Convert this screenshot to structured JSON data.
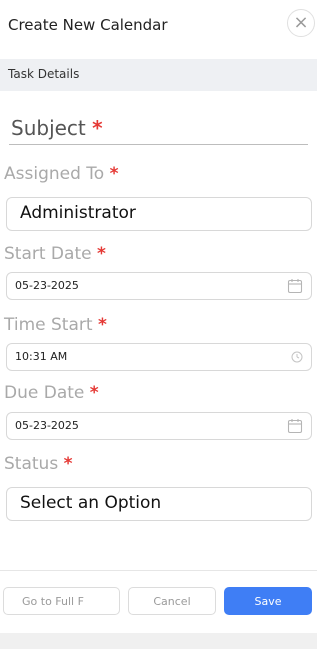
{
  "header": {
    "title": "Create New Calendar",
    "close_glyph": "×"
  },
  "section": {
    "title": "Task Details"
  },
  "form": {
    "required_mark": "*",
    "subject": {
      "label": "Subject"
    },
    "assigned_to": {
      "label": "Assigned To",
      "value": "Administrator"
    },
    "start_date": {
      "label": "Start Date",
      "value": "05-23-2025",
      "icon": "calendar-icon"
    },
    "time_start": {
      "label": "Time Start",
      "value": "10:31 AM",
      "icon": "clock-icon"
    },
    "due_date": {
      "label": "Due Date",
      "value": "05-23-2025",
      "icon": "calendar-icon"
    },
    "status": {
      "label": "Status",
      "value": "Select an Option"
    }
  },
  "footer": {
    "full_form_label": "Go to Full F",
    "cancel_label": "Cancel",
    "save_label": "Save"
  },
  "colors": {
    "accent": "#3f7ef5",
    "required": "#e53935"
  }
}
